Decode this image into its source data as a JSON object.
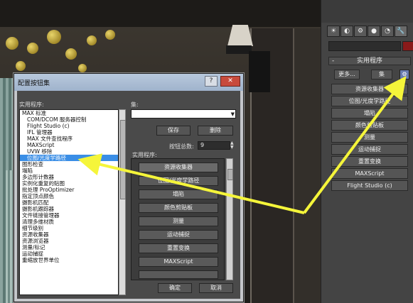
{
  "dialog": {
    "title": "配置按钮集",
    "help": "?",
    "close": "✕",
    "utilities_label": "实用程序:",
    "utilities": [
      {
        "text": "MAX 标准",
        "indent": false
      },
      {
        "text": "COM/DCOM 服务器控制",
        "indent": true
      },
      {
        "text": "Flight Studio (c)",
        "indent": true
      },
      {
        "text": "IFL 管理器",
        "indent": true
      },
      {
        "text": "MAX 文件查找程序",
        "indent": true
      },
      {
        "text": "MAXScript",
        "indent": true
      },
      {
        "text": "UVW 移除",
        "indent": true
      },
      {
        "text": "位图/光度学路径",
        "indent": true,
        "selected": true
      },
      {
        "text": "图形检查",
        "indent": false
      },
      {
        "text": "塌陷",
        "indent": false
      },
      {
        "text": "多边形计数器",
        "indent": false
      },
      {
        "text": "实例化重复的贴图",
        "indent": false
      },
      {
        "text": "批处理 ProOptimizer",
        "indent": false
      },
      {
        "text": "指定顶点颜色",
        "indent": false
      },
      {
        "text": "摄影机匹配",
        "indent": false
      },
      {
        "text": "摄影机跟踪器",
        "indent": false
      },
      {
        "text": "文件链接管理器",
        "indent": false
      },
      {
        "text": "清理多维材质",
        "indent": false
      },
      {
        "text": "细节级别",
        "indent": false
      },
      {
        "text": "资源收集器",
        "indent": false
      },
      {
        "text": "资源浏览器",
        "indent": false
      },
      {
        "text": "测量/标记",
        "indent": false
      },
      {
        "text": "运动捕捉",
        "indent": false
      },
      {
        "text": "重缩放世界单位",
        "indent": false
      }
    ],
    "sets_label": "集:",
    "save": "保存",
    "delete": "删除",
    "total_buttons_label": "按钮总数:",
    "total_buttons_value": "9",
    "utilities_section_label": "实用程序:",
    "configured_buttons": [
      "资源收集器",
      "位图/光度学路径",
      "塌陷",
      "颜色剪贴板",
      "测量",
      "运动捕捉",
      "重置变换",
      "MAXScript",
      ""
    ],
    "ok": "确定",
    "cancel": "取消"
  },
  "command_panel": {
    "tabs": [
      "☀",
      "◐",
      "⚙",
      "●",
      "◔",
      "🔧"
    ],
    "rollout_title": "实用程序",
    "more_button": "更多...",
    "sets_button": "集",
    "config_icon": "⚙",
    "buttons": [
      "资源收集器",
      "位图/光度学路径",
      "塌陷",
      "颜色剪贴板",
      "测量",
      "运动捕捉",
      "重置变换",
      "MAXScript",
      "Flight Studio (c)"
    ]
  },
  "colors": {
    "annotation_arrow": "#f5f53a",
    "selection": "#3a8ee6",
    "panel_bg": "#444444"
  }
}
